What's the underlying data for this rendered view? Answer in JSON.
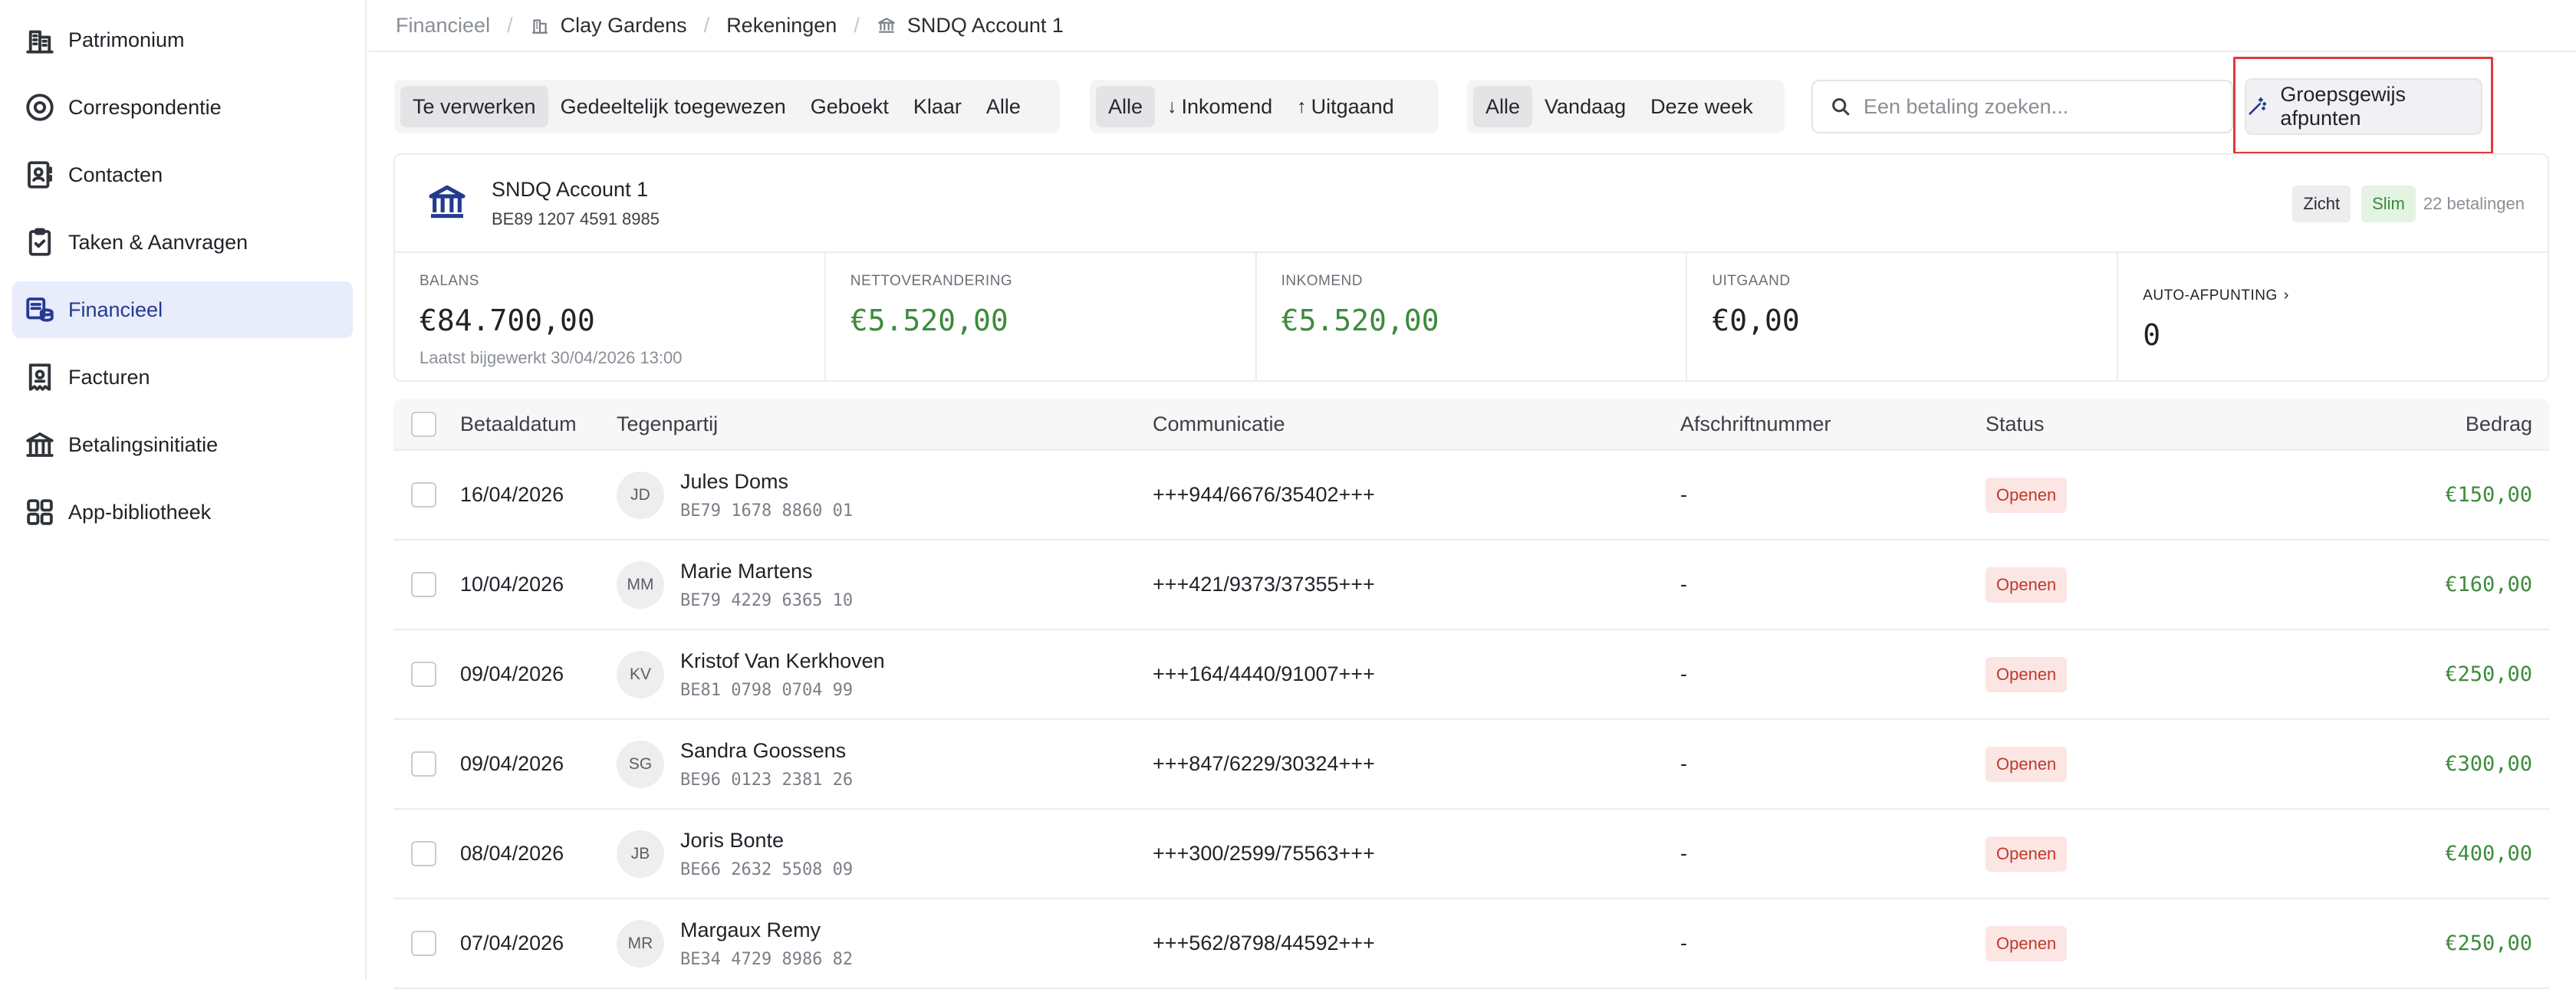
{
  "sidebar": {
    "items": [
      {
        "label": "Patrimonium",
        "icon": "building-icon",
        "active": false
      },
      {
        "label": "Correspondentie",
        "icon": "target-icon",
        "active": false
      },
      {
        "label": "Contacten",
        "icon": "contacts-icon",
        "active": false
      },
      {
        "label": "Taken & Aanvragen",
        "icon": "clipboard-check-icon",
        "active": false
      },
      {
        "label": "Financieel",
        "icon": "coins-icon",
        "active": true
      },
      {
        "label": "Facturen",
        "icon": "receipt-icon",
        "active": false
      },
      {
        "label": "Betalingsinitiatie",
        "icon": "bank-icon",
        "active": false
      },
      {
        "label": "App-bibliotheek",
        "icon": "apps-grid-icon",
        "active": false
      }
    ]
  },
  "breadcrumb": {
    "items": [
      "Financieel",
      "Clay Gardens",
      "Rekeningen",
      "SNDQ Account 1"
    ]
  },
  "filters": {
    "status": [
      "Te verwerken",
      "Gedeeltelijk toegewezen",
      "Geboekt",
      "Klaar",
      "Alle"
    ],
    "status_selected": "Te verwerken",
    "direction": [
      "Alle",
      "Inkomend",
      "Uitgaand"
    ],
    "direction_selected": "Alle",
    "period": [
      "Alle",
      "Vandaag",
      "Deze week"
    ],
    "period_selected": "Alle"
  },
  "search": {
    "placeholder": "Een betaling zoeken...",
    "value": ""
  },
  "group_button": {
    "label": "Groepsgewijs afpunten"
  },
  "account": {
    "name": "SNDQ Account 1",
    "iban": "BE89 1207 4591 8985",
    "tags": [
      "Zicht",
      "Slim"
    ],
    "payments_count": "22 betalingen"
  },
  "stats": {
    "balance_label": "BALANS",
    "balance_value": "€84.700,00",
    "balance_updated": "Laatst bijgewerkt 30/04/2026 13:00",
    "net_label": "NETTOVERANDERING",
    "net_value": "€5.520,00",
    "in_label": "INKOMEND",
    "in_value": "€5.520,00",
    "out_label": "UITGAAND",
    "out_value": "€0,00",
    "auto_label": "AUTO-AFPUNTING",
    "auto_value": "0"
  },
  "table": {
    "headers": {
      "date": "Betaaldatum",
      "party": "Tegenpartij",
      "comm": "Communicatie",
      "stmt": "Afschriftnummer",
      "status": "Status",
      "amount": "Bedrag"
    },
    "rows": [
      {
        "date": "16/04/2026",
        "initials": "JD",
        "name": "Jules Doms",
        "iban": "BE79 1678 8860 01",
        "comm": "+++944/6676/35402+++",
        "stmt": "-",
        "status": "Openen",
        "amount": "€150,00"
      },
      {
        "date": "10/04/2026",
        "initials": "MM",
        "name": "Marie Martens",
        "iban": "BE79 4229 6365 10",
        "comm": "+++421/9373/37355+++",
        "stmt": "-",
        "status": "Openen",
        "amount": "€160,00"
      },
      {
        "date": "09/04/2026",
        "initials": "KV",
        "name": "Kristof Van Kerkhoven",
        "iban": "BE81 0798 0704 99",
        "comm": "+++164/4440/91007+++",
        "stmt": "-",
        "status": "Openen",
        "amount": "€250,00"
      },
      {
        "date": "09/04/2026",
        "initials": "SG",
        "name": "Sandra Goossens",
        "iban": "BE96 0123 2381 26",
        "comm": "+++847/6229/30324+++",
        "stmt": "-",
        "status": "Openen",
        "amount": "€300,00"
      },
      {
        "date": "08/04/2026",
        "initials": "JB",
        "name": "Joris Bonte",
        "iban": "BE66 2632 5508 09",
        "comm": "+++300/2599/75563+++",
        "stmt": "-",
        "status": "Openen",
        "amount": "€400,00"
      },
      {
        "date": "07/04/2026",
        "initials": "MR",
        "name": "Margaux Remy",
        "iban": "BE34 4729 8986 82",
        "comm": "+++562/8798/44592+++",
        "stmt": "-",
        "status": "Openen",
        "amount": "€250,00"
      }
    ]
  },
  "colors": {
    "accent": "#243b8f",
    "positive": "#3d8b3d",
    "status_open_bg": "#fbe6e4",
    "status_open_fg": "#c0392b",
    "highlight": "#e03a3a"
  }
}
